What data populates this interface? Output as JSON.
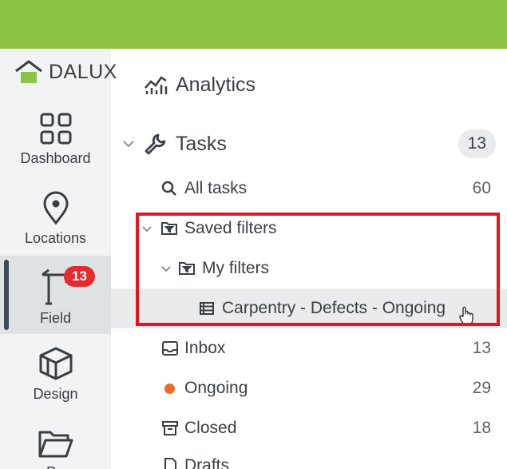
{
  "brand": {
    "logo_text": "DALUX",
    "accent": "#8dc445",
    "badge_color": "#e42b2e",
    "highlight_color": "#e8141c"
  },
  "rail": {
    "items": [
      {
        "label": "Dashboard",
        "icon": "grid-icon"
      },
      {
        "label": "Locations",
        "icon": "map-pin-icon"
      },
      {
        "label": "Field",
        "icon": "crane-icon",
        "badge": "13",
        "active": true
      },
      {
        "label": "Design",
        "icon": "cube-icon"
      },
      {
        "label": "Do",
        "icon": "folder-open-icon"
      }
    ]
  },
  "nav": {
    "analytics": {
      "label": "Analytics",
      "icon": "chart-icon"
    },
    "tasks": {
      "label": "Tasks",
      "count": "13",
      "icon": "wrench-icon"
    },
    "all_tasks": {
      "label": "All tasks",
      "count": "60",
      "icon": "search-icon"
    },
    "saved_filters": {
      "label": "Saved filters",
      "icon": "folder-filter-icon"
    },
    "my_filters": {
      "label": "My filters",
      "icon": "folder-filter-icon"
    },
    "filter_item": {
      "label": "Carpentry - Defects - Ongoing",
      "icon": "list-icon"
    },
    "inbox": {
      "label": "Inbox",
      "count": "13",
      "icon": "inbox-icon"
    },
    "ongoing": {
      "label": "Ongoing",
      "count": "29",
      "dot_color": "#ef6a22"
    },
    "closed": {
      "label": "Closed",
      "count": "18",
      "icon": "archive-icon"
    },
    "drafts": {
      "label": "Drafts",
      "icon": "document-icon"
    }
  }
}
